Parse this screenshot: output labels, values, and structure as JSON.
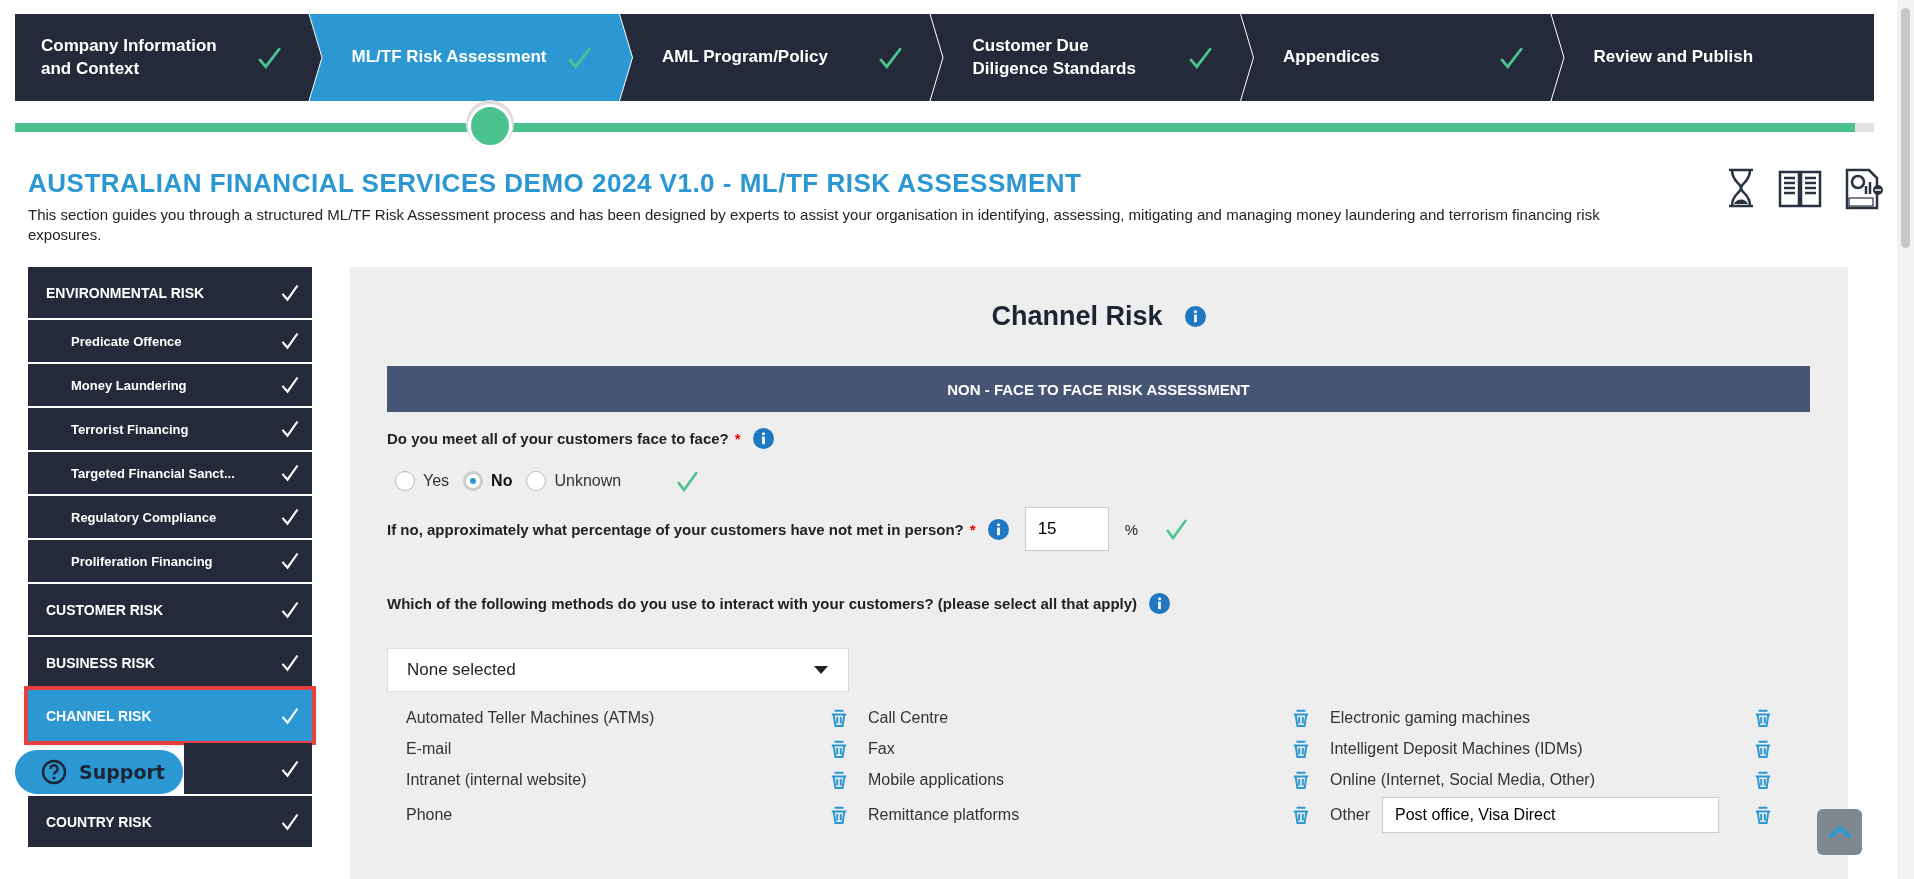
{
  "steps": [
    {
      "label": "Company Information and Context",
      "done": true,
      "selected": false
    },
    {
      "label": "ML/TF Risk Assessment",
      "done": true,
      "selected": true
    },
    {
      "label": "AML Program/Policy",
      "done": true,
      "selected": false
    },
    {
      "label": "Customer Due Diligence Standards",
      "done": true,
      "selected": false
    },
    {
      "label": "Appendices",
      "done": true,
      "selected": false
    },
    {
      "label": "Review and Publish",
      "done": false,
      "selected": false
    }
  ],
  "progress": {
    "level": 0.99
  },
  "page": {
    "title": "AUSTRALIAN FINANCIAL SERVICES DEMO 2024 V1.0 - ML/TF RISK ASSESSMENT",
    "description": "This section guides you through a structured ML/TF Risk Assessment process and has been designed by experts to assist your organisation in identifying, assessing, mitigating and managing money laundering and terrorism financing risk exposures."
  },
  "sidebar": {
    "items": [
      {
        "label": "ENVIRONMENTAL RISK",
        "done": true,
        "selected": false,
        "highlighted": false,
        "children": [
          {
            "label": "Predicate Offence",
            "done": true,
            "selected": false
          },
          {
            "label": "Money Laundering",
            "done": true,
            "selected": false
          },
          {
            "label": "Terrorist Financing",
            "done": true,
            "selected": false
          },
          {
            "label": "Targeted Financial Sanct...",
            "done": true,
            "selected": false
          },
          {
            "label": "Regulatory Compliance",
            "done": true,
            "selected": false
          },
          {
            "label": "Proliferation Financing",
            "done": true,
            "selected": false
          }
        ]
      },
      {
        "label": "CUSTOMER RISK",
        "done": true,
        "selected": false,
        "highlighted": false
      },
      {
        "label": "BUSINESS RISK",
        "done": true,
        "selected": false,
        "highlighted": false
      },
      {
        "label": "CHANNEL RISK",
        "done": true,
        "selected": true,
        "highlighted": true
      },
      {
        "done": true,
        "selected": false,
        "highlighted": false
      },
      {
        "label": "COUNTRY RISK",
        "done": true,
        "selected": false,
        "highlighted": false
      }
    ]
  },
  "support_button": {
    "label": "Support"
  },
  "form": {
    "title": "Channel Risk",
    "section": "NON - FACE TO FACE RISK ASSESSMENT",
    "q1": {
      "question": "Do you meet all of your customers face to face?",
      "required": true,
      "required_mark": "*",
      "answered": true,
      "options": [
        {
          "label": "Yes",
          "selected": false
        },
        {
          "label": "No",
          "selected": true
        },
        {
          "label": "Unknown",
          "selected": false
        }
      ]
    },
    "q2": {
      "question": "If no, approximately what percentage of your customers have not met in person?",
      "required": true,
      "required_mark": "*",
      "value": "15",
      "unit": "%",
      "answered": true
    },
    "q3": {
      "question": "Which of the following methods do you use to interact with your customers? (please select all that apply)",
      "dropdown": "None selected",
      "methods": [
        {
          "kind": "plain",
          "label": "Automated Teller Machines (ATMs)"
        },
        {
          "kind": "plain",
          "label": "Call Centre"
        },
        {
          "kind": "plain",
          "label": "Electronic gaming machines"
        },
        {
          "kind": "plain",
          "label": "E-mail"
        },
        {
          "kind": "plain",
          "label": "Fax"
        },
        {
          "kind": "plain",
          "label": "Intelligent Deposit Machines (IDMs)"
        },
        {
          "kind": "plain",
          "label": "Intranet (internal website)"
        },
        {
          "kind": "plain",
          "label": "Mobile applications"
        },
        {
          "kind": "plain",
          "label": "Online (Internet, Social Media, Other)"
        },
        {
          "kind": "plain",
          "label": "Phone"
        },
        {
          "kind": "plain",
          "label": "Remittance platforms"
        },
        {
          "kind": "other",
          "label": "Other",
          "value": "Post office, Visa Direct"
        }
      ]
    }
  }
}
